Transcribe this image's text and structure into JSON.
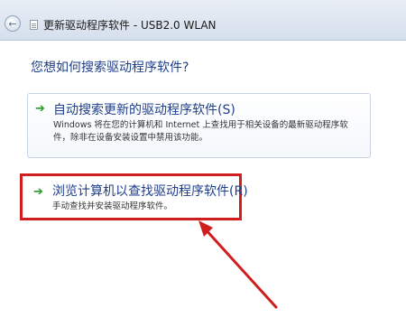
{
  "window": {
    "title": "更新驱动程序软件 - USB2.0 WLAN",
    "back_icon": "back-arrow-icon",
    "title_icon": "document-icon"
  },
  "main": {
    "question": "您想如何搜索驱动程序软件?",
    "options": [
      {
        "title": "自动搜索更新的驱动程序软件(S)",
        "description": "Windows 将在您的计算机和 Internet 上查找用于相关设备的最新驱动程序软件，除非在设备安装设置中禁用该功能。",
        "icon": "green-arrow-icon"
      },
      {
        "title": "浏览计算机以查找驱动程序软件(R)",
        "description": "手动查找并安装驱动程序软件。",
        "icon": "green-arrow-icon"
      }
    ]
  },
  "annotation": {
    "highlight_color": "#d01e1e",
    "arrow_color": "#d01e1e"
  }
}
